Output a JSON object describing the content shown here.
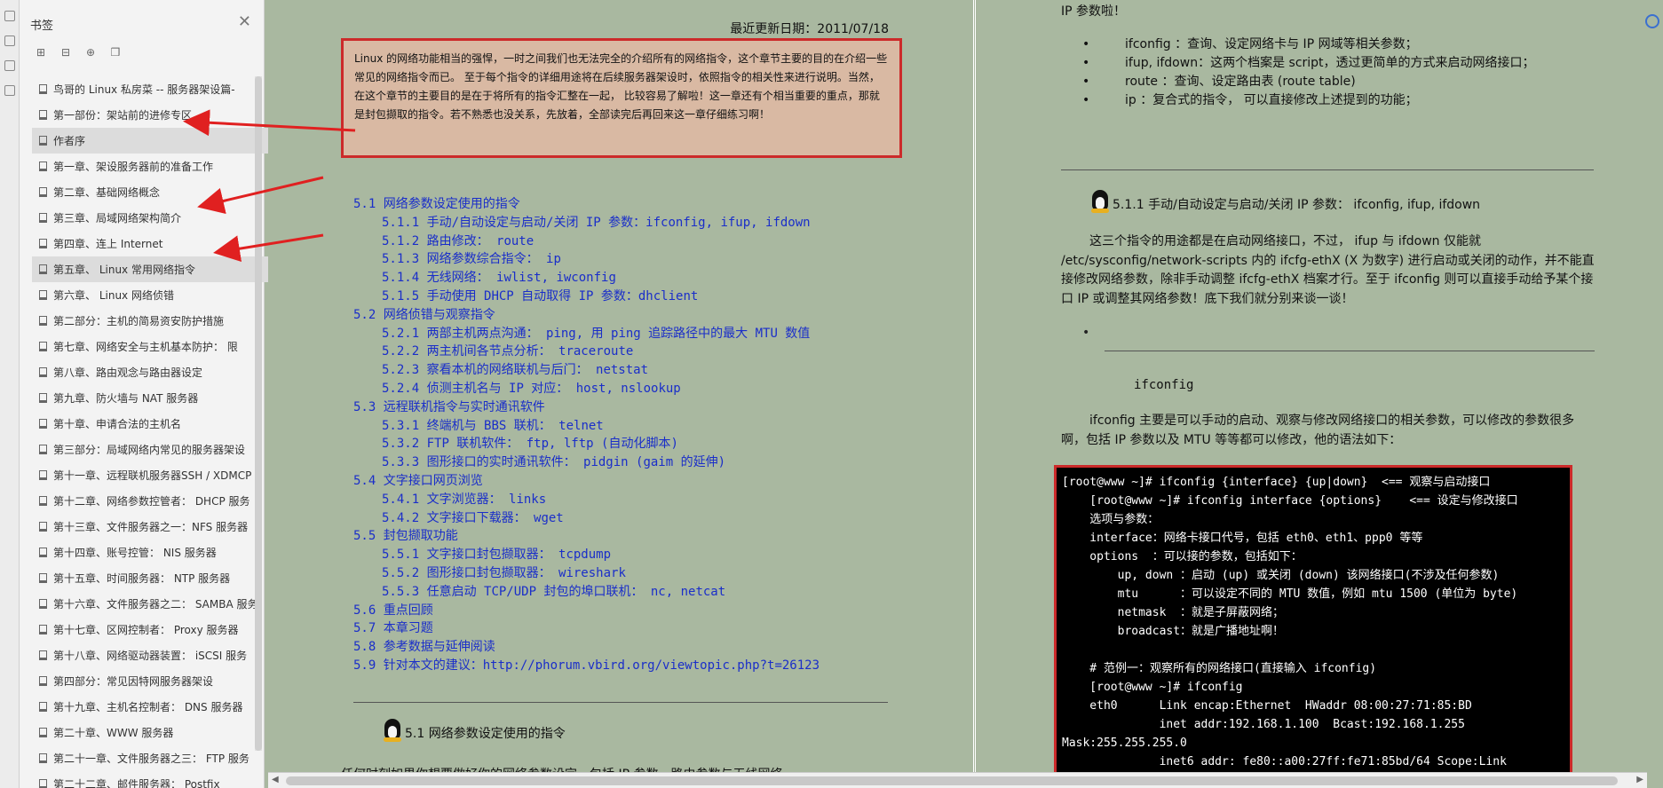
{
  "bookmarks_panel": {
    "title": "书签",
    "close_icon": "close-icon",
    "items": [
      {
        "label": "鸟哥的 Linux 私房菜 -- 服务器架设篇-",
        "selected": false
      },
      {
        "label": "第一部份：架站前的进修专区",
        "selected": false
      },
      {
        "label": "作者序",
        "selected": true
      },
      {
        "label": "第一章、架设服务器前的准备工作",
        "selected": false
      },
      {
        "label": "第二章、基础网络概念",
        "selected": false
      },
      {
        "label": "第三章、局域网络架构简介",
        "selected": false
      },
      {
        "label": "第四章、连上 Internet",
        "selected": false
      },
      {
        "label": "第五章、 Linux 常用网络指令",
        "selected": true
      },
      {
        "label": "第六章、 Linux 网络侦错",
        "selected": false
      },
      {
        "label": "第二部分：主机的简易资安防护措施",
        "selected": false
      },
      {
        "label": "第七章、网络安全与主机基本防护：  限",
        "selected": false
      },
      {
        "label": "第八章、路由观念与路由器设定",
        "selected": false
      },
      {
        "label": "第九章、防火墙与 NAT 服务器",
        "selected": false
      },
      {
        "label": "第十章、申请合法的主机名",
        "selected": false
      },
      {
        "label": "第三部分：局域网络内常见的服务器架设",
        "selected": false
      },
      {
        "label": "第十一章、远程联机服务器SSH / XDMCP",
        "selected": false
      },
      {
        "label": "第十二章、网络参数控管者： DHCP 服务",
        "selected": false
      },
      {
        "label": "第十三章、文件服务器之一：NFS 服务器",
        "selected": false
      },
      {
        "label": "第十四章、账号控管： NIS 服务器",
        "selected": false
      },
      {
        "label": "第十五章、时间服务器： NTP 服务器",
        "selected": false
      },
      {
        "label": "第十六章、文件服务器之二： SAMBA 服务",
        "selected": false
      },
      {
        "label": "第十七章、区网控制者： Proxy 服务器",
        "selected": false
      },
      {
        "label": "第十八章、网络驱动器装置： iSCSI 服务",
        "selected": false
      },
      {
        "label": "第四部分：常见因特网服务器架设",
        "selected": false
      },
      {
        "label": "第十九章、主机名控制者： DNS 服务器",
        "selected": false
      },
      {
        "label": "第二十章、WWW 服务器",
        "selected": false
      },
      {
        "label": "第二十一章、文件服务器之三： FTP 服务",
        "selected": false
      },
      {
        "label": "第二十二章、邮件服务器： Postfix",
        "selected": false
      }
    ]
  },
  "left_page": {
    "update_date": "最近更新日期：2011/07/18",
    "intro": "Linux 的网络功能相当的强悍，一时之间我们也无法完全的介绍所有的网络指令，这个章节主要的目的在介绍一些常见的网络指令而已。 至于每个指令的详细用途将在后续服务器架设时，依照指令的相关性来进行说明。当然，在这个章节的主要目的是在于将所有的指令汇整在一起， 比较容易了解啦！这一章还有个相当重要的重点，那就是封包撷取的指令。若不熟悉也没关系，先放着，全部读完后再回来这一章仔细练习啊！",
    "toc": [
      {
        "num": "5.1",
        "text": "网络参数设定使用的指令",
        "level": 1
      },
      {
        "num": "5.1.1",
        "text": "手动/自动设定与启动/关闭 IP 参数：ifconfig, ifup, ifdown",
        "level": 2
      },
      {
        "num": "5.1.2",
        "text": "路由修改： route",
        "level": 2
      },
      {
        "num": "5.1.3",
        "text": "网络参数综合指令： ip",
        "level": 2
      },
      {
        "num": "5.1.4",
        "text": "无线网络： iwlist, iwconfig",
        "level": 2
      },
      {
        "num": "5.1.5",
        "text": "手动使用 DHCP 自动取得 IP 参数：dhclient",
        "level": 2
      },
      {
        "num": "5.2",
        "text": "网络侦错与观察指令",
        "level": 1
      },
      {
        "num": "5.2.1",
        "text": "两部主机两点沟通： ping, 用 ping 追踪路径中的最大 MTU 数值",
        "level": 2
      },
      {
        "num": "5.2.2",
        "text": "两主机间各节点分析： traceroute",
        "level": 2
      },
      {
        "num": "5.2.3",
        "text": "察看本机的网络联机与后门： netstat",
        "level": 2
      },
      {
        "num": "5.2.4",
        "text": "侦测主机名与 IP 对应： host, nslookup",
        "level": 2
      },
      {
        "num": "5.3",
        "text": "远程联机指令与实时通讯软件",
        "level": 1
      },
      {
        "num": "5.3.1",
        "text": "终端机与 BBS 联机： telnet",
        "level": 2
      },
      {
        "num": "5.3.2",
        "text": "FTP 联机软件： ftp, lftp (自动化脚本)",
        "level": 2
      },
      {
        "num": "5.3.3",
        "text": "图形接口的实时通讯软件： pidgin (gaim 的延伸)",
        "level": 2
      },
      {
        "num": "5.4",
        "text": "文字接口网页浏览",
        "level": 1
      },
      {
        "num": "5.4.1",
        "text": "文字浏览器： links",
        "level": 2
      },
      {
        "num": "5.4.2",
        "text": "文字接口下载器： wget",
        "level": 2
      },
      {
        "num": "5.5",
        "text": "封包撷取功能",
        "level": 1
      },
      {
        "num": "5.5.1",
        "text": "文字接口封包撷取器： tcpdump",
        "level": 2
      },
      {
        "num": "5.5.2",
        "text": "图形接口封包撷取器： wireshark",
        "level": 2
      },
      {
        "num": "5.5.3",
        "text": "任意启动 TCP/UDP 封包的埠口联机： nc, netcat",
        "level": 2
      },
      {
        "num": "5.6",
        "text": "重点回顾",
        "level": 1
      },
      {
        "num": "5.7",
        "text": "本章习题",
        "level": 1
      },
      {
        "num": "5.8",
        "text": "参考数据与延伸阅读",
        "level": 1
      },
      {
        "num": "5.9",
        "text": "针对本文的建议：http://phorum.vbird.org/viewtopic.php?t=26123",
        "level": 1
      }
    ],
    "section_heading": "5.1 网络参数设定使用的指令",
    "partial_line": "任何时刻如果你想要做好你的网络参数设定，包括 IP 参数、路由参数与无线网络"
  },
  "right_page": {
    "top_line": "IP 参数啦！",
    "bullets": [
      "ifconfig ：查询、设定网络卡与 IP 网域等相关参数；",
      "ifup, ifdown：这两个档案是 script，透过更简单的方式来启动网络接口；",
      "route ：查询、设定路由表 (route table)",
      "ip ：复合式的指令， 可以直接修改上述提到的功能；"
    ],
    "section_heading": "5.1.1 手动/自动设定与启动/关闭 IP 参数： ifconfig, ifup, ifdown",
    "para1": "这三个指令的用途都是在启动网络接口，不过， ifup 与 ifdown 仅能就 /etc/sysconfig/network-scripts 内的 ifcfg-ethX (X 为数字) 进行启动或关闭的动作，并不能直接修改网络参数，除非手动调整 ifcfg-ethX 档案才行。至于 ifconfig 则可以直接手动给予某个接口 IP 或调整其网络参数！底下我们就分别来谈一谈！",
    "cmd_label": "ifconfig",
    "para2": "ifconfig 主要是可以手动的启动、观察与修改网络接口的相关参数，可以修改的参数很多啊，包括 IP 参数以及 MTU 等等都可以修改，他的语法如下：",
    "code": "[root@www ~]# ifconfig {interface} {up|down}  <== 观察与启动接口\n    [root@www ~]# ifconfig interface {options}    <== 设定与修改接口\n    选项与参数：\n    interface：网络卡接口代号，包括 eth0、eth1、ppp0 等等\n    options  ：可以接的参数，包括如下：\n        up, down ：启动 (up) 或关闭 (down) 该网络接口(不涉及任何参数)\n        mtu      ：可以设定不同的 MTU 数值，例如 mtu 1500 (单位为 byte)\n        netmask  ：就是子屏蔽网络；\n        broadcast：就是广播地址啊！\n\n    # 范例一：观察所有的网络接口(直接输入 ifconfig)\n    [root@www ~]# ifconfig\n    eth0      Link encap:Ethernet  HWaddr 08:00:27:71:85:BD\n              inet addr:192.168.1.100  Bcast:192.168.1.255\nMask:255.255.255.0\n              inet6 addr: fe80::a00:27ff:fe71:85bd/64 Scope:Link"
  },
  "colors": {
    "page_bg": "#a9b8a0",
    "link": "#1a2ec9",
    "highlight_border": "#cc2a2a",
    "intro_bg": "#d9b9a3",
    "arrow": "#e02020"
  }
}
